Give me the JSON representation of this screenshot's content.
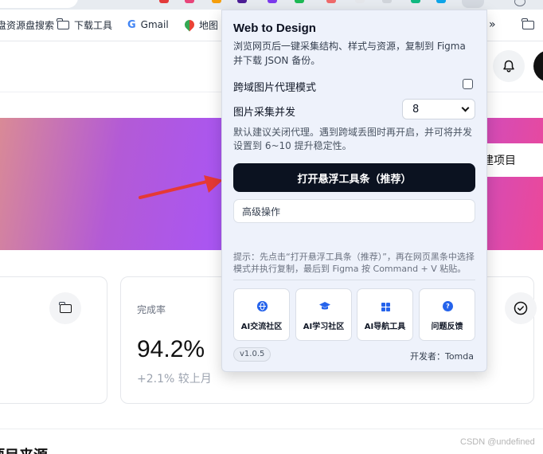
{
  "bookmarks": [
    {
      "label": "盘资源盘搜索",
      "icon": "folder-icon"
    },
    {
      "label": "下载工具",
      "icon": "folder-icon"
    },
    {
      "label": "Gmail",
      "icon": "google-icon"
    },
    {
      "label": "地图",
      "icon": "maps-icon"
    },
    {
      "label": "»",
      "icon": "more-bookmarks-icon"
    }
  ],
  "hero": {
    "button_label": "建项目"
  },
  "stat_card": {
    "title": "完成率",
    "value": "94.2%",
    "trend": "+2.1% 较上月"
  },
  "bottom_heading": "项目来源",
  "watermark": "CSDN @undefined",
  "popup": {
    "title": "Web to Design",
    "description": "浏览网页后一键采集结构、样式与资源，复制到 Figma 并下载 JSON 备份。",
    "proxy_label": "跨域图片代理模式",
    "proxy_checked": false,
    "concurrency_label": "图片采集并发",
    "concurrency_value": "8",
    "hint": "默认建议关闭代理。遇到跨域丢图时再开启，并可将并发设置到 6~10 提升稳定性。",
    "primary_button": "打开悬浮工具条（推荐）",
    "advanced_label": "高级操作",
    "tip": "提示：先点击“打开悬浮工具条（推荐）”，再在网页黑条中选择模式并执行复制，最后到 Figma 按 Command + V 粘贴。",
    "links": [
      {
        "label": "AI交流社区",
        "icon": "globe-icon"
      },
      {
        "label": "AI学习社区",
        "icon": "graduation-cap-icon"
      },
      {
        "label": "AI导航工具",
        "icon": "grid-icon"
      },
      {
        "label": "问题反馈",
        "icon": "help-icon"
      }
    ],
    "version": "v1.0.5",
    "developer": "开发者：Tomda"
  },
  "colors": {
    "primary_button_bg": "#0b1220",
    "accent_blue": "#2563eb",
    "arrow_red": "#e53935",
    "popup_bg": "#eef2fb"
  }
}
